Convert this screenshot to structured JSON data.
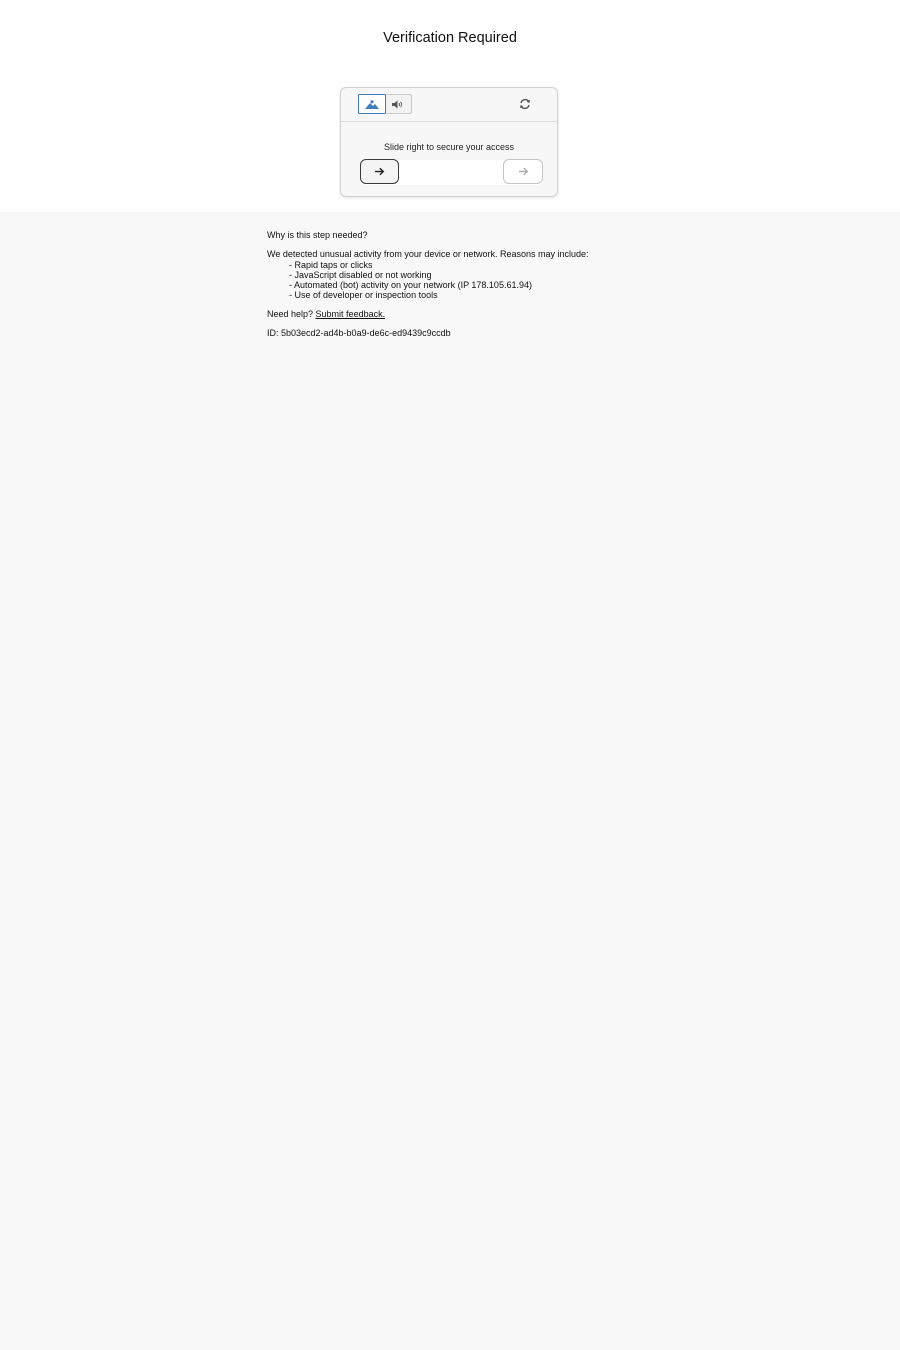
{
  "page": {
    "title": "Verification Required"
  },
  "captcha": {
    "modes": [
      {
        "name": "image",
        "icon": "image-icon",
        "selected": true
      },
      {
        "name": "audio",
        "icon": "speaker-icon",
        "selected": false
      }
    ],
    "refresh_icon": "refresh-icon",
    "instruction": "Slide right to secure your access",
    "handle_icon": "arrow-right-icon",
    "target_icon": "arrow-right-icon",
    "accent_color": "#3f7cc0"
  },
  "info": {
    "question": "Why is this step needed?",
    "intro": "We detected unusual activity from your device or network. Reasons may include:",
    "reasons": [
      "- Rapid taps or clicks",
      "- JavaScript disabled or not working",
      "- Automated (bot) activity on your network (IP 178.105.61.94)",
      "- Use of developer or inspection tools"
    ],
    "help_prefix": "Need help? ",
    "help_link": "Submit feedback.",
    "id_line": "ID: 5b03ecd2-ad4b-b0a9-de6c-ed9439c9ccdb"
  }
}
